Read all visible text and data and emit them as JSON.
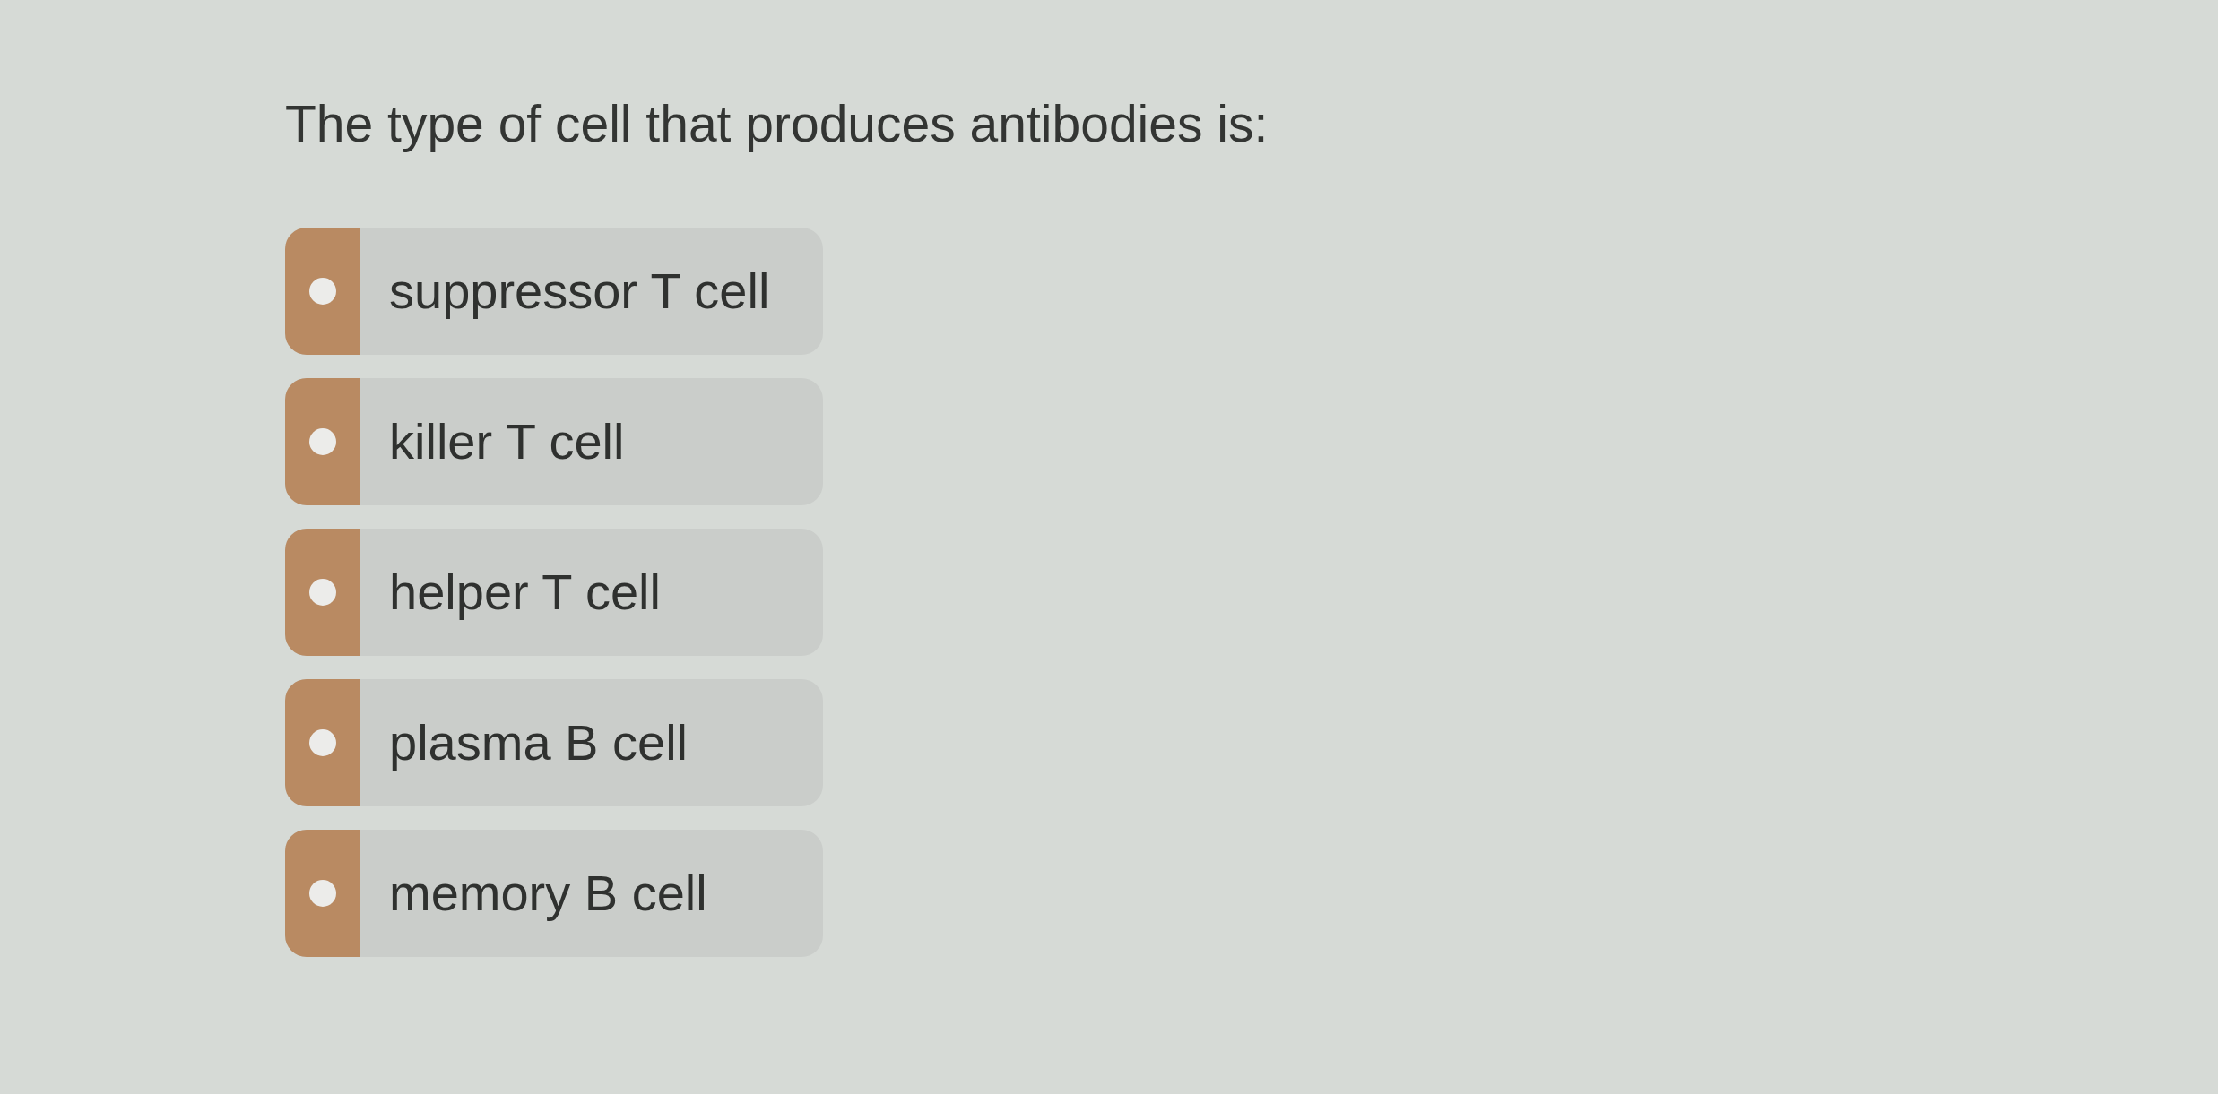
{
  "question": "The type of cell that produces antibodies is:",
  "options": [
    {
      "label": "suppressor T cell",
      "selected": false
    },
    {
      "label": "killer T cell",
      "selected": false
    },
    {
      "label": "helper T cell",
      "selected": false
    },
    {
      "label": "plasma B cell",
      "selected": false
    },
    {
      "label": "memory B cell",
      "selected": false
    }
  ]
}
